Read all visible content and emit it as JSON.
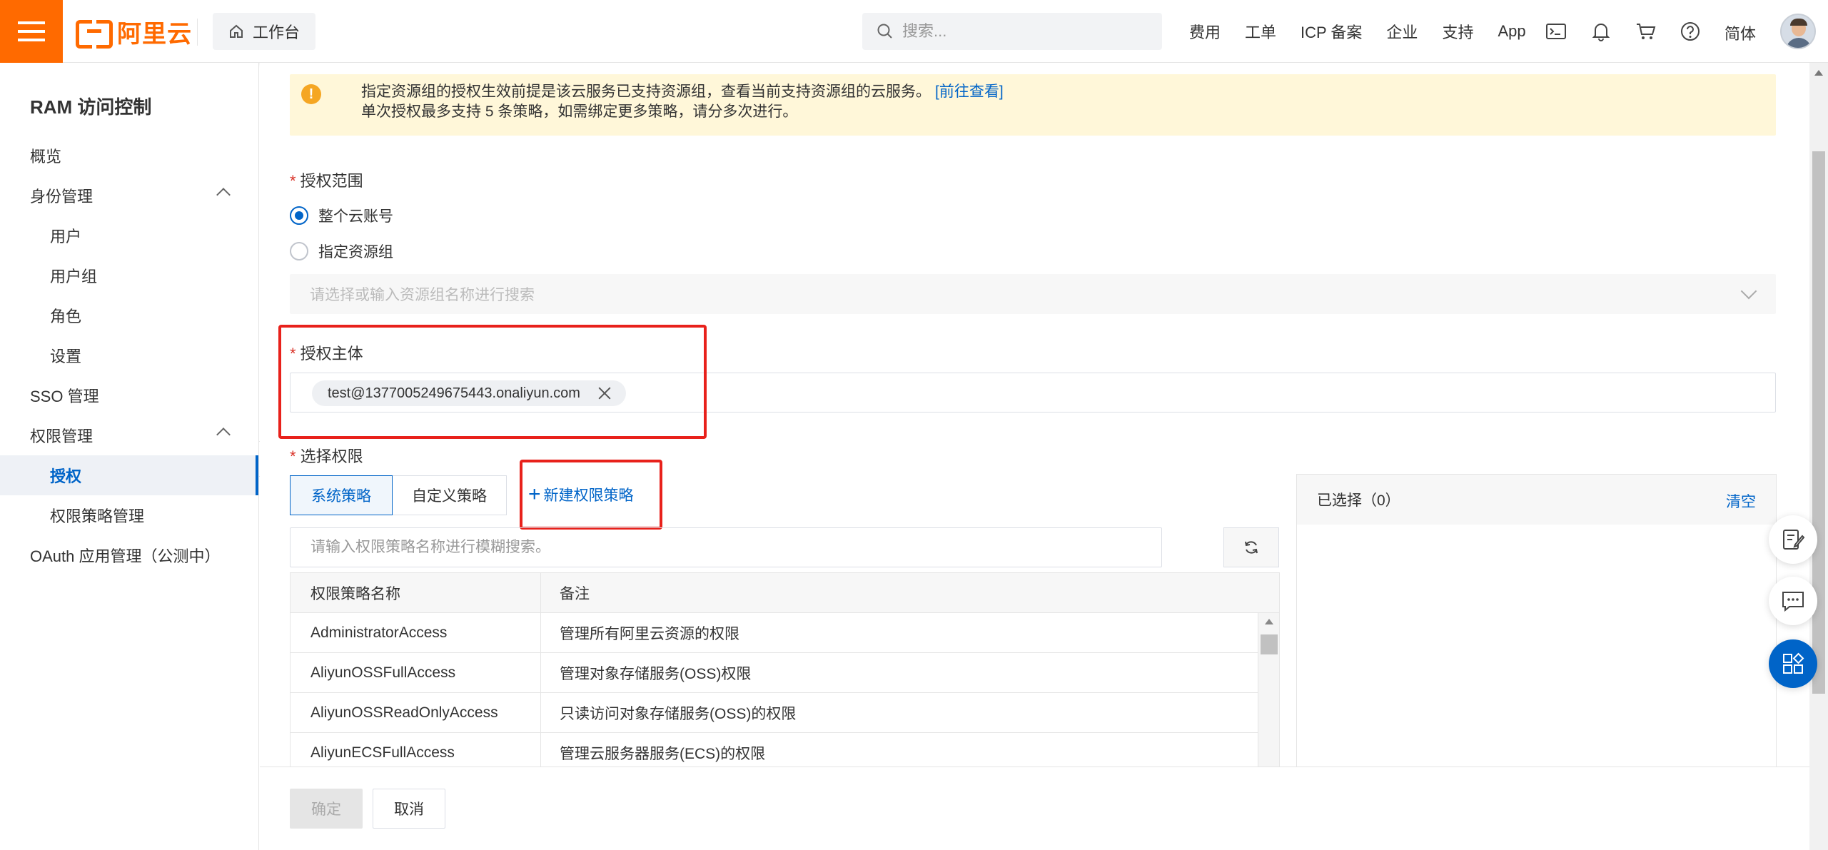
{
  "topbar": {
    "logo_text": "阿里云",
    "workbench_label": "工作台",
    "search_placeholder": "搜索...",
    "nav_links": [
      "费用",
      "工单",
      "ICP 备案",
      "企业",
      "支持",
      "App"
    ],
    "lang": "简体",
    "icons": [
      "terminal-icon",
      "bell-icon",
      "cart-icon",
      "help-icon"
    ]
  },
  "sidebar": {
    "title": "RAM 访问控制",
    "items": [
      {
        "label": "概览",
        "sub": false
      },
      {
        "label": "身份管理",
        "sub": false,
        "expandable": true
      },
      {
        "label": "用户",
        "sub": true
      },
      {
        "label": "用户组",
        "sub": true
      },
      {
        "label": "角色",
        "sub": true
      },
      {
        "label": "设置",
        "sub": true
      },
      {
        "label": "SSO 管理",
        "sub": false
      },
      {
        "label": "权限管理",
        "sub": false,
        "expandable": true
      },
      {
        "label": "授权",
        "sub": true,
        "active": true
      },
      {
        "label": "权限策略管理",
        "sub": true
      },
      {
        "label": "OAuth 应用管理（公测中）",
        "sub": false
      }
    ]
  },
  "alert": {
    "line1": "指定资源组的授权生效前提是该云服务已支持资源组，查看当前支持资源组的云服务。",
    "link": "[前往查看]",
    "line2": "单次授权最多支持 5 条策略，如需绑定更多策略，请分多次进行。"
  },
  "scope": {
    "label": "授权范围",
    "options": [
      "整个云账号",
      "指定资源组"
    ],
    "selected": "整个云账号",
    "resource_group_placeholder": "请选择或输入资源组名称进行搜索"
  },
  "principal": {
    "label": "授权主体",
    "tag": "test@1377005249675443.onaliyun.com"
  },
  "permissions": {
    "label": "选择权限",
    "tabs": [
      "系统策略",
      "自定义策略"
    ],
    "active_tab": "系统策略",
    "new_policy_label": "新建权限策略",
    "search_placeholder": "请输入权限策略名称进行模糊搜索。",
    "columns": [
      "权限策略名称",
      "备注"
    ],
    "rows": [
      {
        "name": "AdministratorAccess",
        "note": "管理所有阿里云资源的权限"
      },
      {
        "name": "AliyunOSSFullAccess",
        "note": "管理对象存储服务(OSS)权限"
      },
      {
        "name": "AliyunOSSReadOnlyAccess",
        "note": "只读访问对象存储服务(OSS)的权限"
      },
      {
        "name": "AliyunECSFullAccess",
        "note": "管理云服务器服务(ECS)的权限"
      }
    ]
  },
  "selected": {
    "title": "已选择（0）",
    "clear": "清空"
  },
  "footer": {
    "ok": "确定",
    "cancel": "取消"
  },
  "colors": {
    "brand": "#ff6a00",
    "primary": "#0064c8",
    "highlight": "#e8211b",
    "alert_bg": "#fff7d9"
  }
}
